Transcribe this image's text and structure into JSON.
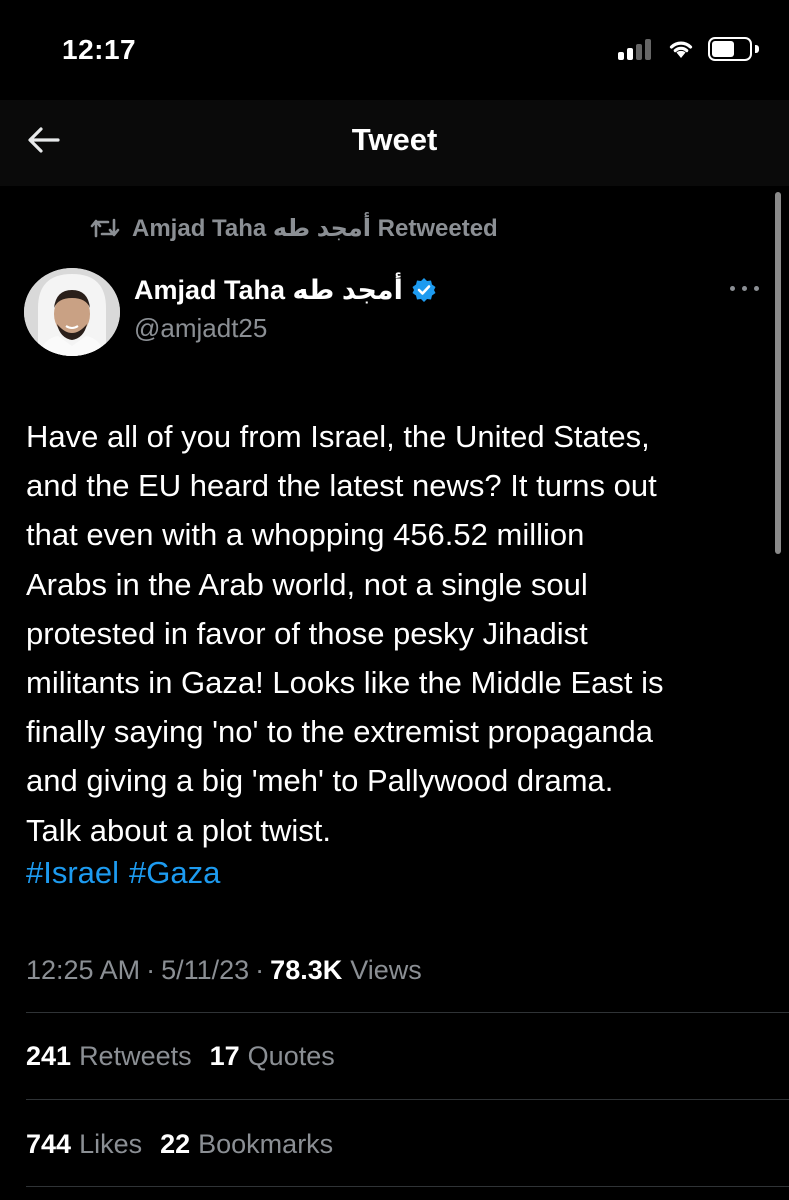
{
  "status_bar": {
    "time": "12:17"
  },
  "header": {
    "title": "Tweet"
  },
  "retweet": {
    "text": "Amjad Taha أمجد طه Retweeted"
  },
  "author": {
    "name": "Amjad Taha أمجد طه",
    "handle": "@amjadt25"
  },
  "tweet": {
    "lines": [
      "Have all of you from Israel, the United States,",
      "and the EU heard the latest news? It turns out",
      "that even with a whopping 456.52 million",
      "Arabs in the Arab world, not a single soul",
      "protested in favor of those pesky Jihadist",
      "militants in Gaza! Looks like the Middle East is",
      "finally saying 'no' to the extremist propaganda",
      "and giving a big 'meh' to Pallywood drama.",
      "Talk about a plot twist."
    ],
    "hashtags": [
      "#Israel",
      "#Gaza"
    ]
  },
  "meta": {
    "time": "12:25 AM",
    "sep1": "·",
    "date": "5/11/23",
    "sep2": "·",
    "views_count": "78.3K",
    "views_label": "Views"
  },
  "stats": {
    "retweets_count": "241",
    "retweets_label": "Retweets",
    "quotes_count": "17",
    "quotes_label": "Quotes",
    "likes_count": "744",
    "likes_label": "Likes",
    "bookmarks_count": "22",
    "bookmarks_label": "Bookmarks"
  },
  "colors": {
    "background": "#000000",
    "accent": "#1d9bf0",
    "muted": "#8b8f94",
    "text": "#ffffff"
  }
}
